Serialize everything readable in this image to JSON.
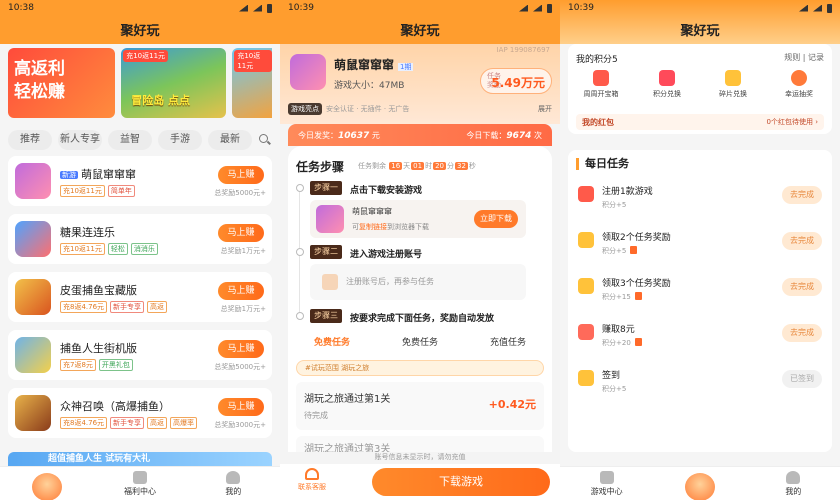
{
  "s1": {
    "time": "10:38",
    "title": "聚好玩",
    "banner": {
      "b1": "高返利\n轻松赚",
      "b2_tag": "充10返11元",
      "b2_text": "冒险岛 点点",
      "b3_tag": "充10返11元"
    },
    "cats": [
      "推荐",
      "新人专享",
      "益智",
      "手游",
      "最新"
    ],
    "games": [
      {
        "name": "萌鼠窜窜窜",
        "new": "新游",
        "tags": [
          "充10返11元",
          "简单年"
        ],
        "earn": "马上赚",
        "total": "总奖励5000元+"
      },
      {
        "name": "糖果连连乐",
        "tags": [
          "充10返11元",
          "轻松",
          "消消乐"
        ],
        "earn": "马上赚",
        "total": "总奖励1万元+"
      },
      {
        "name": "皮蛋捕鱼宝藏版",
        "tags": [
          "充8返4.76元",
          "新手专享",
          "高返"
        ],
        "earn": "马上赚",
        "total": "总奖励1万元+"
      },
      {
        "name": "捕鱼人生街机版",
        "tags": [
          "充7返8元",
          "开黑礼包"
        ],
        "earn": "马上赚",
        "total": "总奖励5000元+"
      },
      {
        "name": "众神召唤（高爆捕鱼）",
        "tags": [
          "充8返4.76元",
          "新手专享",
          "高返",
          "高爆率"
        ],
        "earn": "马上赚",
        "total": "总奖励3000元+"
      }
    ],
    "bottom_banner": "超值捕鱼人生 试玩有大礼",
    "tabs": {
      "welfare": "福利中心",
      "mine": "我的"
    }
  },
  "s2": {
    "time": "10:39",
    "title": "聚好玩",
    "game_name": "萌鼠窜窜窜",
    "tag": "1期",
    "size": "游戏大小：47MB",
    "iap": "IAP 199087697",
    "reward_label": "任务奖励",
    "reward_value": "5.49万元",
    "strip_badge": "游戏亮点",
    "strip_text": "安全认证 · 无插件 · 无广告",
    "strip_more": "展开",
    "today_users_label": "今日发奖：",
    "today_users": "10637",
    "today_users_unit": "元",
    "today_dl_label": "今日下载：",
    "today_dl": "9674",
    "today_dl_unit": "次",
    "steps_title": "任务步骤",
    "steps_sub": "任务剩余",
    "cd": [
      "16",
      "天",
      "01",
      "时",
      "20",
      "分",
      "32",
      "秒"
    ],
    "step1_badge": "步骤一",
    "step1_text": "点击下载安装游戏",
    "step1_name": "萌鼠窜窜窜",
    "step1_hint_pre": "可",
    "step1_hint_link": "复制链接",
    "step1_hint_post": "到浏览器下载",
    "step1_btn": "立即下载",
    "step2_badge": "步骤二",
    "step2_text": "进入游戏注册账号",
    "step2_box": "注册账号后，再参与任务",
    "step3_badge": "步骤三",
    "step3_text": "按要求完成下面任务，奖励自动发放",
    "task_tabs": [
      "免费任务",
      "免费任务",
      "充值任务"
    ],
    "notice": "#试玩范围 湖玩之旅",
    "task1_title": "湖玩之旅通过第1关",
    "task1_status": "待完成",
    "task1_value": "+0.42元",
    "task2_title": "湖玩之旅通过第3关",
    "tip": "账号信息未显示时，请勿充值",
    "service": "联系客服",
    "download": "下载游戏"
  },
  "s3": {
    "time": "10:39",
    "title": "聚好玩",
    "points_label": "我的积分5",
    "rules": "规则",
    "records": "记录",
    "icons": [
      "周周开宝箱",
      "积分兑换",
      "碎片兑换",
      "幸运抽奖"
    ],
    "redbag": "我的红包",
    "redbag_hint": "0个红包待使用 ›",
    "daily_title": "每日任务",
    "tasks": [
      {
        "title": "注册1款游戏",
        "sub": "积分+5",
        "btn": "去完成"
      },
      {
        "title": "领取2个任务奖励",
        "sub": "积分+5",
        "btn": "去完成"
      },
      {
        "title": "领取3个任务奖励",
        "sub": "积分+15",
        "btn": "去完成"
      },
      {
        "title": "赚取8元",
        "sub": "积分+20",
        "btn": "去完成"
      },
      {
        "title": "签到",
        "sub": "积分+5",
        "btn": "已签到"
      }
    ],
    "tabs": {
      "center": "游戏中心",
      "mine": "我的"
    }
  },
  "colors": {
    "primary": "#ff9d2e",
    "accent": "#ff6a1a"
  }
}
